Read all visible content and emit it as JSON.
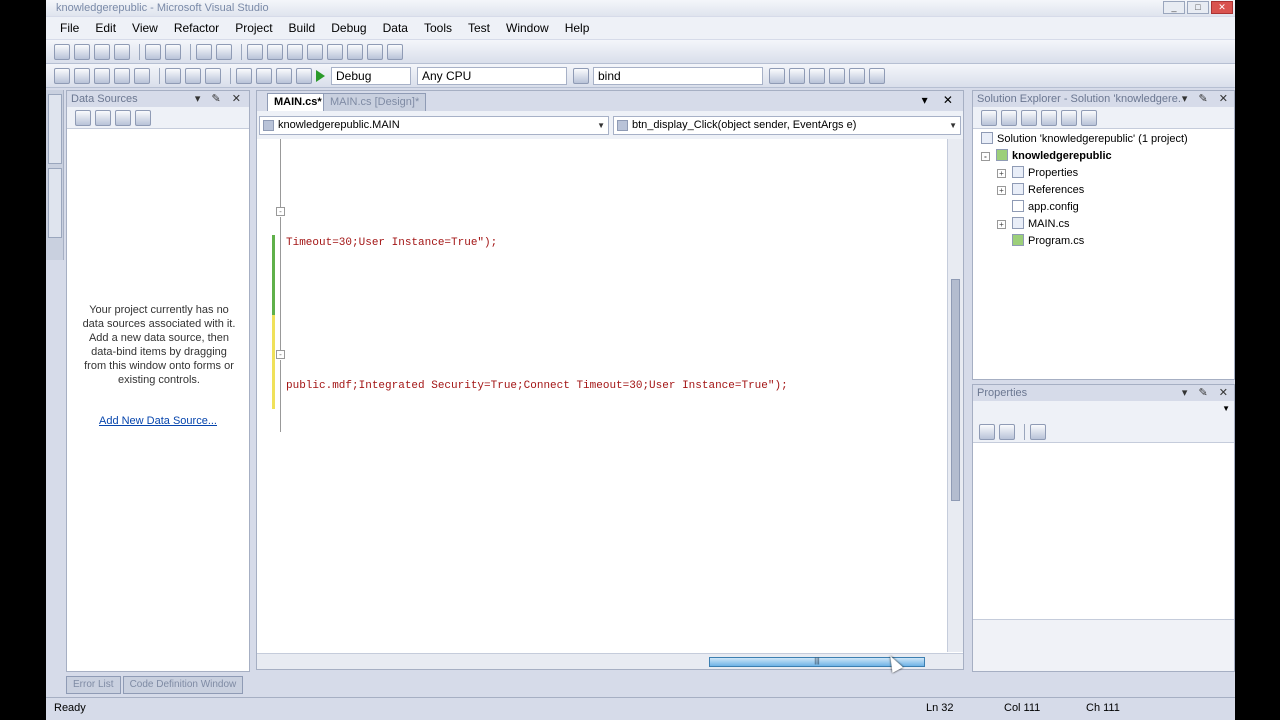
{
  "window": {
    "title": "knowledgerepublic - Microsoft Visual Studio",
    "controls": [
      "_",
      "□",
      "✕"
    ]
  },
  "menu": [
    "File",
    "Edit",
    "View",
    "Refactor",
    "Project",
    "Build",
    "Debug",
    "Data",
    "Tools",
    "Test",
    "Window",
    "Help"
  ],
  "toolbar": {
    "config": "Debug",
    "platform": "Any CPU",
    "find": "bind"
  },
  "data_sources": {
    "title": "Data Sources",
    "controls": "▾ ✎ ✕",
    "message": "Your project currently has no data sources associated with it. Add a new data source, then data-bind items by dragging from this window onto forms or existing controls.",
    "link": "Add New Data Source..."
  },
  "editor": {
    "tabs": [
      "MAIN.cs*",
      "MAIN.cs [Design]*"
    ],
    "tab_controls": "▾ ✕",
    "class_combo": "knowledgerepublic.MAIN",
    "member_combo": "btn_display_Click(object sender, EventArgs e)",
    "lines": [
      "Timeout=30;User Instance=True\");",
      "public.mdf;Integrated Security=True;Connect Timeout=30;User Instance=True\");"
    ]
  },
  "solution_explorer": {
    "title": "Solution Explorer - Solution 'knowledgere...",
    "controls": "▾ ✎ ✕",
    "solution": "Solution 'knowledgerepublic' (1 project)",
    "project": "knowledgerepublic",
    "items": [
      "Properties",
      "References",
      "app.config",
      "MAIN.cs",
      "Program.cs"
    ]
  },
  "properties": {
    "title": "Properties",
    "controls": "▾ ✎ ✕"
  },
  "bottom_tabs": [
    "Error List",
    "Code Definition Window"
  ],
  "status": {
    "text": "Ready",
    "ln": "Ln 32",
    "col": "Col 111",
    "ch": "Ch 111"
  }
}
